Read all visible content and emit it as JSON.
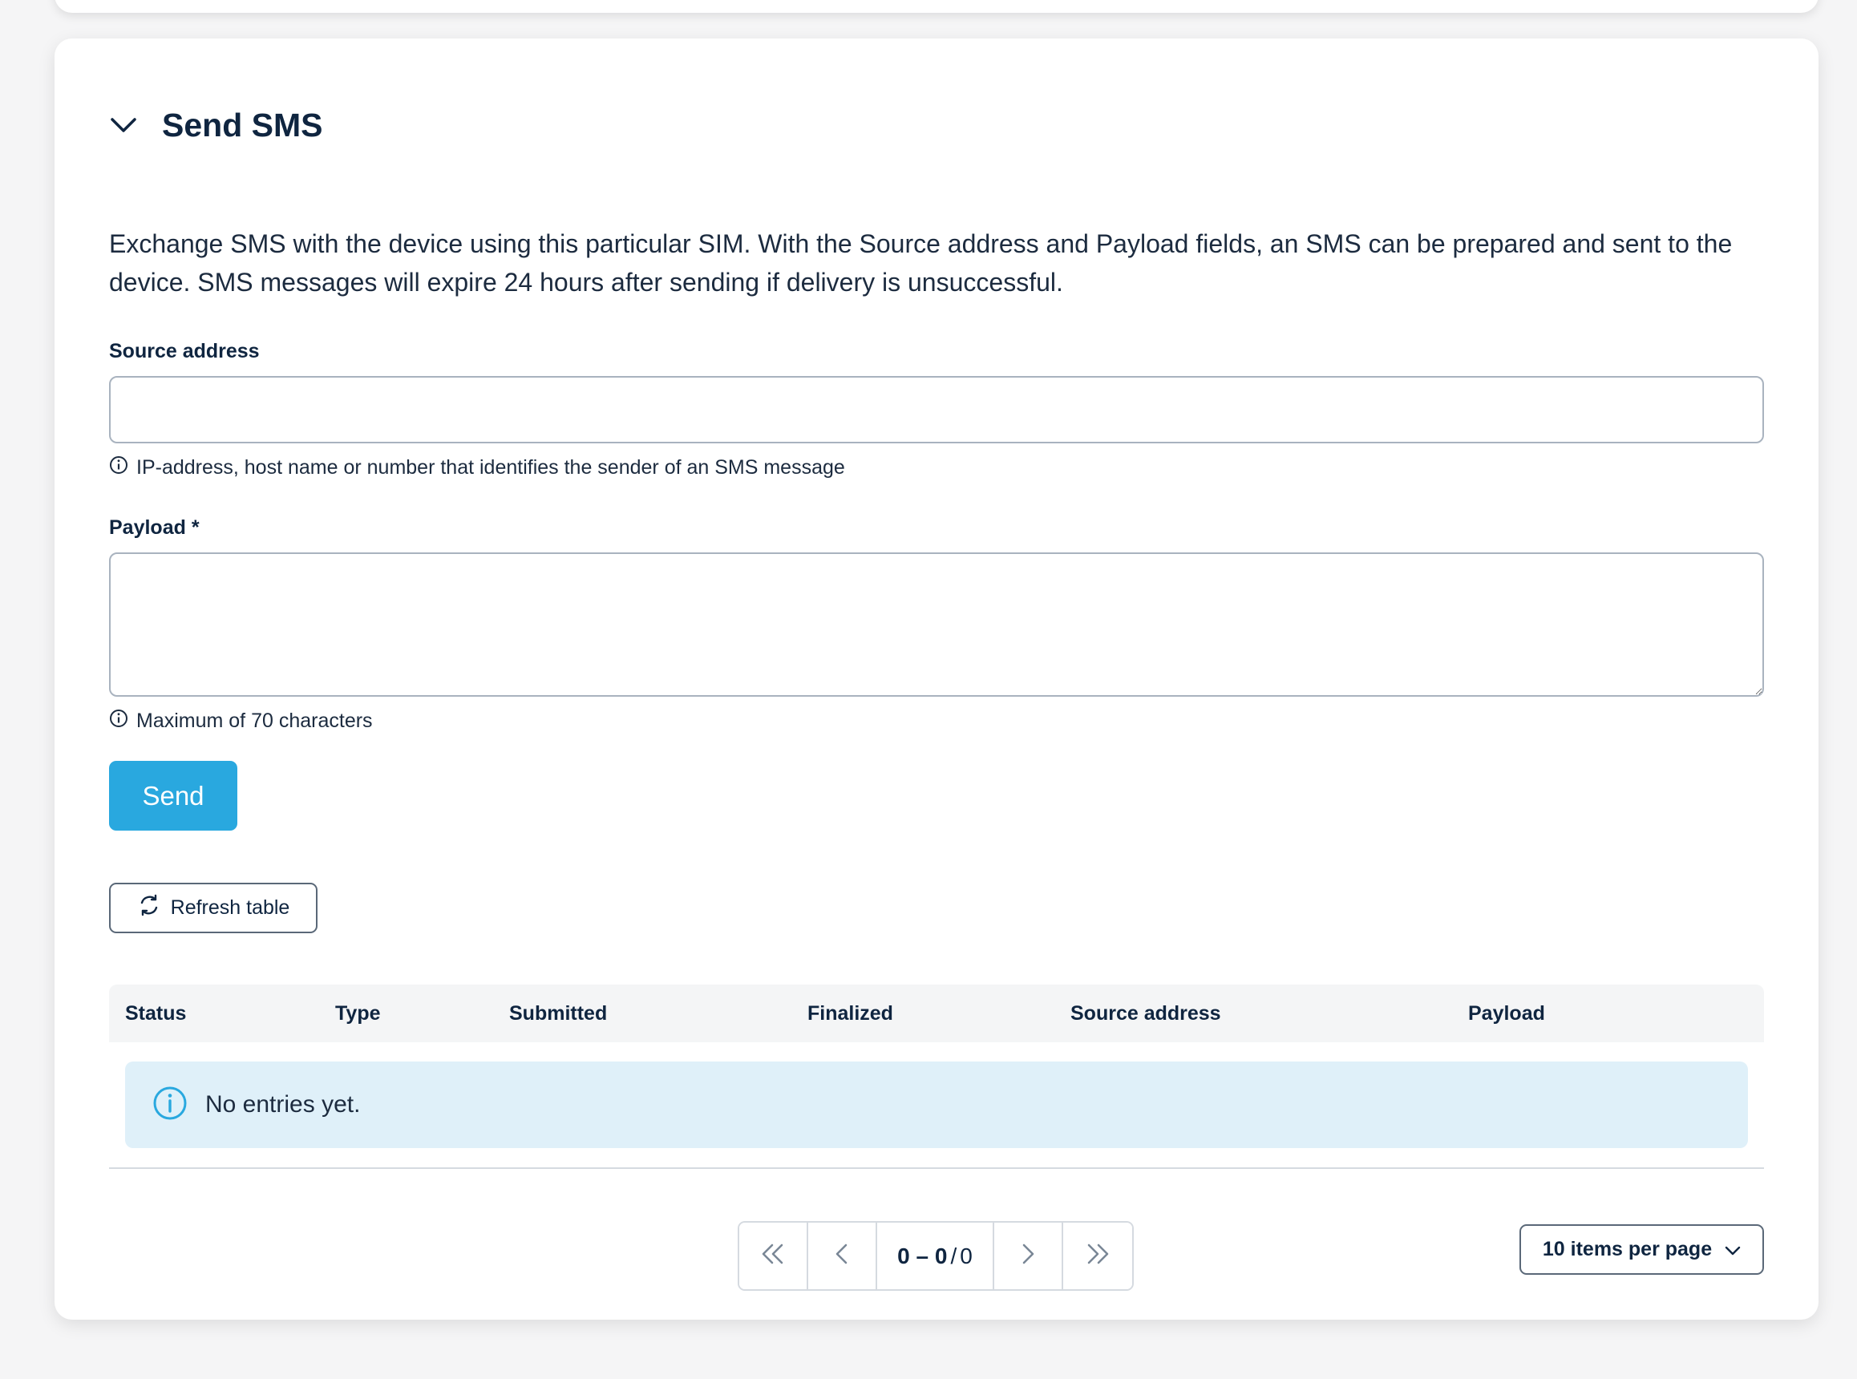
{
  "section": {
    "title": "Send SMS",
    "description": "Exchange SMS with the device using this particular SIM. With the Source address and Payload fields, an SMS can be prepared and sent to the device. SMS messages will expire 24 hours after sending if delivery is unsuccessful."
  },
  "form": {
    "source_label": "Source address",
    "source_value": "",
    "source_hint": "IP-address, host name or number that identifies the sender of an SMS message",
    "payload_label": "Payload *",
    "payload_value": "",
    "payload_hint": "Maximum of 70 characters",
    "send_label": "Send"
  },
  "table": {
    "refresh_label": "Refresh table",
    "columns": [
      "Status",
      "Type",
      "Submitted",
      "Finalized",
      "Source address",
      "Payload"
    ],
    "empty_message": "No entries yet."
  },
  "pagination": {
    "range_start_end": "0 – 0",
    "separator": "/",
    "total": "0",
    "items_per_page_label": "10 items per page"
  },
  "colors": {
    "accent": "#29a8df",
    "info_bg": "#dff0f9",
    "text": "#0f2540"
  },
  "icons": {
    "collapse": "chevron-down-icon",
    "hint": "info-icon",
    "refresh": "refresh-icon",
    "first": "double-chevron-left-icon",
    "prev": "chevron-left-icon",
    "next": "chevron-right-icon",
    "last": "double-chevron-right-icon",
    "dropdown": "chevron-down-icon"
  }
}
